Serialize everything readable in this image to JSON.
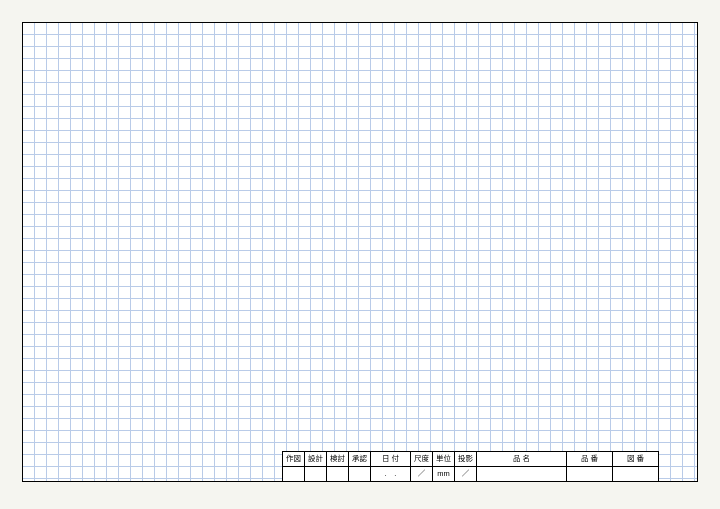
{
  "titleblock": {
    "headers": {
      "sakuzu": "作図",
      "sekkei": "設計",
      "kento": "検討",
      "shounin": "承認",
      "hizuke": "日 付",
      "shakudo": "尺度",
      "tani": "単位",
      "touei": "投影",
      "hinmei": "品  名",
      "hinban": "品  番",
      "zuban": "図  番"
    },
    "values": {
      "sakuzu": "",
      "sekkei": "",
      "kento": "",
      "shounin": "",
      "hizuke": ".　.",
      "shakudo": "／",
      "tani": "mm",
      "touei": "／",
      "hinmei": "",
      "hinban": "",
      "zuban": ""
    }
  }
}
